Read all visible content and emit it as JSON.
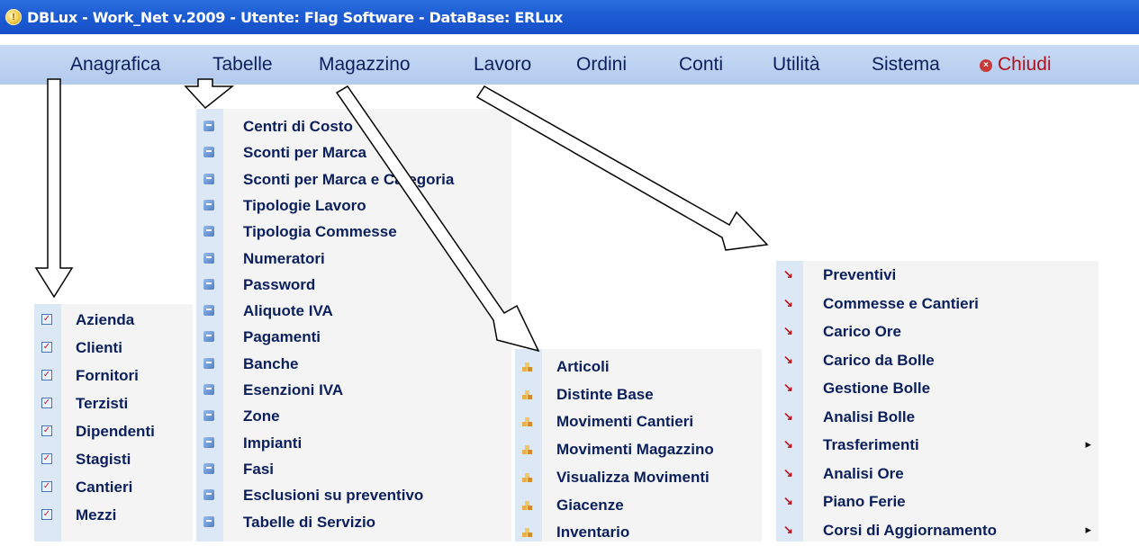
{
  "window": {
    "title": "DBLux  -  Work_Net v.2009  -  Utente: Flag Software  -  DataBase: ERLux"
  },
  "menu": {
    "items": [
      {
        "label": "Anagrafica"
      },
      {
        "label": "Tabelle"
      },
      {
        "label": "Magazzino"
      },
      {
        "label": "Lavoro"
      },
      {
        "label": "Ordini"
      },
      {
        "label": "Conti"
      },
      {
        "label": "Utilità"
      },
      {
        "label": "Sistema"
      },
      {
        "label": "Chiudi"
      }
    ]
  },
  "anagrafica": {
    "icon": "checkbox-icon",
    "items": [
      "Azienda",
      "Clienti",
      "Fornitori",
      "Terzisti",
      "Dipendenti",
      "Stagisti",
      "Cantieri",
      "Mezzi"
    ]
  },
  "tabelle": {
    "icon": "document-icon",
    "items": [
      "Centri di Costo",
      "Sconti per Marca",
      "Sconti per Marca e Categoria",
      "Tipologie Lavoro",
      "Tipologia Commesse",
      "Numeratori",
      "Password",
      "Aliquote IVA",
      "Pagamenti",
      "Banche",
      "Esenzioni IVA",
      "Zone",
      "Impianti",
      "Fasi",
      "Esclusioni su preventivo",
      "Tabelle di Servizio"
    ]
  },
  "magazzino": {
    "icon": "boxes-icon",
    "items": [
      "Articoli",
      "Distinte Base",
      "Movimenti Cantieri",
      "Movimenti Magazzino",
      "Visualizza Movimenti",
      "Giacenze",
      "Inventario"
    ]
  },
  "lavoro": {
    "icon": "pin-icon",
    "items": [
      {
        "label": "Preventivi",
        "submenu": false
      },
      {
        "label": "Commesse e Cantieri",
        "submenu": false
      },
      {
        "label": "Carico Ore",
        "submenu": false
      },
      {
        "label": "Carico da Bolle",
        "submenu": false
      },
      {
        "label": "Gestione Bolle",
        "submenu": false
      },
      {
        "label": "Analisi Bolle",
        "submenu": false
      },
      {
        "label": "Trasferimenti",
        "submenu": true
      },
      {
        "label": "Analisi Ore",
        "submenu": false
      },
      {
        "label": "Piano Ferie",
        "submenu": false
      },
      {
        "label": "Corsi di Aggiornamento",
        "submenu": true
      }
    ]
  },
  "colors": {
    "titlebar": "#1d5cd3",
    "menubar": "#b3caee",
    "menu_text": "#0b1f5c",
    "close_text": "#b2101a"
  }
}
